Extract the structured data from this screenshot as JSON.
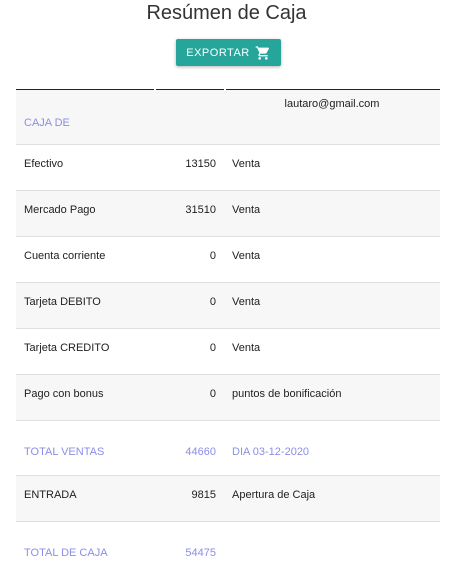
{
  "page": {
    "title": "Resúmen de Caja"
  },
  "toolbar": {
    "export_label": "EXPORTAR",
    "export_icon": "cart-icon"
  },
  "header": {
    "label": "CAJA DE",
    "email": "lautaro@gmail.com"
  },
  "rows": [
    {
      "label": "Efectivo",
      "amount": "13150",
      "note": "Venta"
    },
    {
      "label": "Mercado Pago",
      "amount": "31510",
      "note": "Venta"
    },
    {
      "label": "Cuenta corriente",
      "amount": "0",
      "note": "Venta"
    },
    {
      "label": "Tarjeta DEBITO",
      "amount": "0",
      "note": "Venta"
    },
    {
      "label": "Tarjeta CREDITO",
      "amount": "0",
      "note": "Venta"
    },
    {
      "label": "Pago con bonus",
      "amount": "0",
      "note": "puntos de bonificación"
    }
  ],
  "total_ventas": {
    "label": "TOTAL VENTAS",
    "amount": "44660",
    "note": "DIA 03-12-2020"
  },
  "entrada": {
    "label": "ENTRADA",
    "amount": "9815",
    "note": "Apertura de Caja"
  },
  "total_caja": {
    "label": "TOTAL DE CAJA",
    "amount": "54475"
  },
  "colors": {
    "accent": "#8c8ee6",
    "button": "#26a69a",
    "row_shade": "#f7f7f7"
  }
}
